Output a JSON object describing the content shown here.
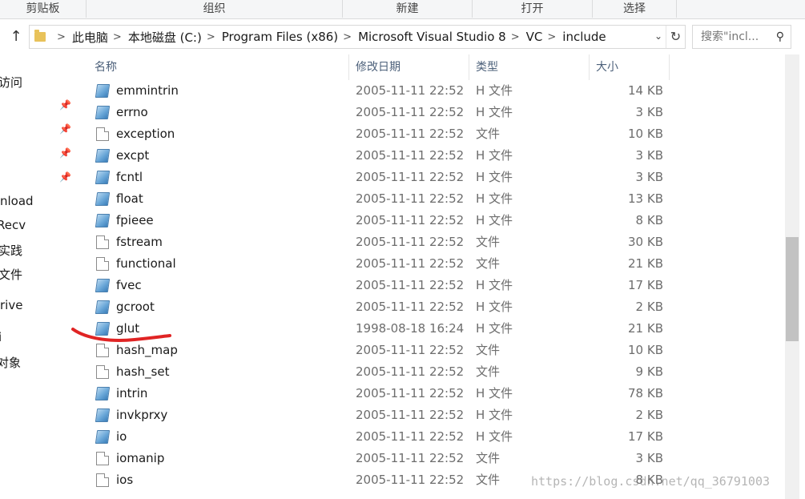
{
  "ribbon": {
    "groups": [
      "剪贴板",
      "组织",
      "新建",
      "打开",
      "选择"
    ]
  },
  "address": {
    "crumbs": [
      "此电脑",
      "本地磁盘 (C:)",
      "Program Files (x86)",
      "Microsoft Visual Studio 8",
      "VC",
      "include"
    ],
    "separator": ">",
    "dropdown_icon": "chevron-down-icon",
    "refresh_icon": "refresh-icon",
    "up_icon": "arrow-up-icon"
  },
  "search": {
    "placeholder": "搜索\"incl...",
    "icon": "search-icon"
  },
  "nav": {
    "items": [
      "访问",
      "nload",
      "Recv",
      "实践",
      "文件",
      "rive",
      "i",
      "对象"
    ]
  },
  "columns": {
    "name": "名称",
    "date": "修改日期",
    "type": "类型",
    "size": "大小"
  },
  "files": [
    {
      "name": "emmintrin",
      "date": "2005-11-11 22:52",
      "type": "H 文件",
      "size": "14 KB",
      "icon": "h-file-icon"
    },
    {
      "name": "errno",
      "date": "2005-11-11 22:52",
      "type": "H 文件",
      "size": "3 KB",
      "icon": "h-file-icon"
    },
    {
      "name": "exception",
      "date": "2005-11-11 22:52",
      "type": "文件",
      "size": "10 KB",
      "icon": "file-icon"
    },
    {
      "name": "excpt",
      "date": "2005-11-11 22:52",
      "type": "H 文件",
      "size": "3 KB",
      "icon": "h-file-icon"
    },
    {
      "name": "fcntl",
      "date": "2005-11-11 22:52",
      "type": "H 文件",
      "size": "3 KB",
      "icon": "h-file-icon"
    },
    {
      "name": "float",
      "date": "2005-11-11 22:52",
      "type": "H 文件",
      "size": "13 KB",
      "icon": "h-file-icon"
    },
    {
      "name": "fpieee",
      "date": "2005-11-11 22:52",
      "type": "H 文件",
      "size": "8 KB",
      "icon": "h-file-icon"
    },
    {
      "name": "fstream",
      "date": "2005-11-11 22:52",
      "type": "文件",
      "size": "30 KB",
      "icon": "file-icon"
    },
    {
      "name": "functional",
      "date": "2005-11-11 22:52",
      "type": "文件",
      "size": "21 KB",
      "icon": "file-icon"
    },
    {
      "name": "fvec",
      "date": "2005-11-11 22:52",
      "type": "H 文件",
      "size": "17 KB",
      "icon": "h-file-icon"
    },
    {
      "name": "gcroot",
      "date": "2005-11-11 22:52",
      "type": "H 文件",
      "size": "2 KB",
      "icon": "h-file-icon"
    },
    {
      "name": "glut",
      "date": "1998-08-18 16:24",
      "type": "H 文件",
      "size": "21 KB",
      "icon": "h-file-icon"
    },
    {
      "name": "hash_map",
      "date": "2005-11-11 22:52",
      "type": "文件",
      "size": "10 KB",
      "icon": "file-icon"
    },
    {
      "name": "hash_set",
      "date": "2005-11-11 22:52",
      "type": "文件",
      "size": "9 KB",
      "icon": "file-icon"
    },
    {
      "name": "intrin",
      "date": "2005-11-11 22:52",
      "type": "H 文件",
      "size": "78 KB",
      "icon": "h-file-icon"
    },
    {
      "name": "invkprxy",
      "date": "2005-11-11 22:52",
      "type": "H 文件",
      "size": "2 KB",
      "icon": "h-file-icon"
    },
    {
      "name": "io",
      "date": "2005-11-11 22:52",
      "type": "H 文件",
      "size": "17 KB",
      "icon": "h-file-icon"
    },
    {
      "name": "iomanip",
      "date": "2005-11-11 22:52",
      "type": "文件",
      "size": "3 KB",
      "icon": "file-icon"
    },
    {
      "name": "ios",
      "date": "2005-11-11 22:52",
      "type": "文件",
      "size": "8 KB",
      "icon": "file-icon"
    }
  ],
  "annotation": {
    "color": "#e02424",
    "target": "glut"
  },
  "watermark": "https://blog.csdn.net/qq_36791003"
}
